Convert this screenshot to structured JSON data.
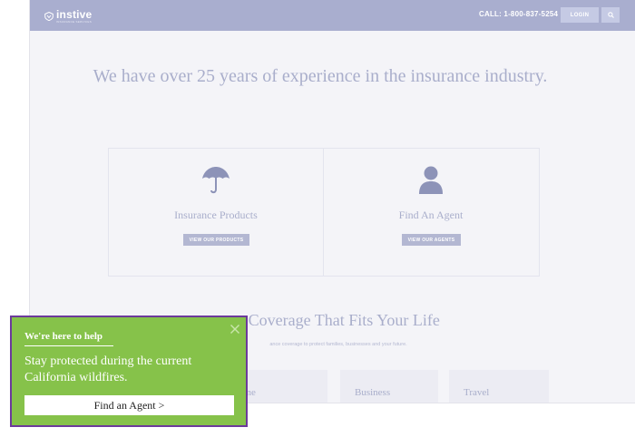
{
  "header": {
    "logo_name": "instive",
    "logo_tagline": "INSURANCE SERVICES",
    "call": "CALL: 1-800-837-5254",
    "login_label": "LOGIN",
    "search_icon": "search-icon",
    "bar_color": "#a9aecf"
  },
  "hero": {
    "headline": "We have over 25 years of experience in the insurance industry."
  },
  "cards": [
    {
      "icon": "umbrella-icon",
      "title": "Insurance Products",
      "button": "VIEW OUR PRODUCTS"
    },
    {
      "icon": "person-icon",
      "title": "Find An Agent",
      "button": "VIEW OUR AGENTS"
    }
  ],
  "coverage": {
    "title": "e Coverage That Fits Your Life",
    "subtitle": "ance coverage to protect families, businesses and your future.",
    "items": [
      "Home",
      "Business",
      "Travel"
    ]
  },
  "popup": {
    "heading": "We're here to help",
    "body": "Stay protected during the current California wildfires.",
    "button": "Find an Agent >",
    "close_icon": "close-icon",
    "bg_color": "#86c24a",
    "border_color": "#6c3a9b"
  }
}
